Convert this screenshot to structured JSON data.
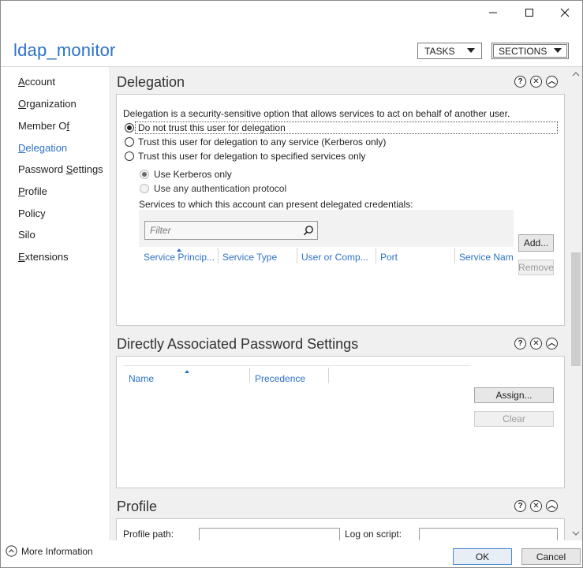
{
  "app": {
    "title": "ldap_monitor"
  },
  "header": {
    "tasks_label": "TASKS",
    "sections_label": "SECTIONS"
  },
  "nav": {
    "items": [
      {
        "pre": "",
        "u": "A",
        "post": "ccount",
        "active": false
      },
      {
        "pre": "",
        "u": "O",
        "post": "rganization",
        "active": false
      },
      {
        "pre": "Member O",
        "u": "f",
        "post": "",
        "active": false
      },
      {
        "pre": "",
        "u": "D",
        "post": "elegation",
        "active": true
      },
      {
        "pre": "Password ",
        "u": "S",
        "post": "ettings",
        "active": false
      },
      {
        "pre": "",
        "u": "P",
        "post": "rofile",
        "active": false
      },
      {
        "pre": "Policy",
        "u": "",
        "post": "",
        "active": false
      },
      {
        "pre": "Silo",
        "u": "",
        "post": "",
        "active": false
      },
      {
        "pre": "",
        "u": "E",
        "post": "xtensions",
        "active": false
      }
    ]
  },
  "delegation": {
    "title": "Delegation",
    "description": "Delegation is a security-sensitive option that allows services to act on behalf of another user.",
    "options": [
      {
        "label": "Do not trust this user for delegation",
        "checked": true
      },
      {
        "label": "Trust this user for delegation to any service (Kerberos only)",
        "checked": false
      },
      {
        "label": "Trust this user for delegation to specified services only",
        "checked": false
      }
    ],
    "sub_options": [
      {
        "label": "Use Kerberos only",
        "checked": true
      },
      {
        "label": "Use any authentication protocol",
        "checked": false
      }
    ],
    "services_label": "Services to which this account can present delegated credentials:",
    "filter_placeholder": "Filter",
    "columns": [
      "Service Princip...",
      "Service Type",
      "User or Comp...",
      "Port",
      "Service Name"
    ],
    "add_label": "Add...",
    "remove_label": "Remove"
  },
  "password_settings": {
    "title": "Directly Associated Password Settings",
    "columns": [
      "Name",
      "Precedence"
    ],
    "assign_label": "Assign...",
    "clear_label": "Clear"
  },
  "profile": {
    "title": "Profile",
    "profile_path_label": "Profile path:",
    "logon_script_label": "Log on script:"
  },
  "footer": {
    "more_info_label": "More Information",
    "ok_label": "OK",
    "cancel_label": "Cancel"
  },
  "colors": {
    "accent": "#2c72c7"
  },
  "icons": [
    "minimize-icon",
    "maximize-icon",
    "close-icon",
    "help-icon",
    "remove-section-icon",
    "collapse-section-icon",
    "search-icon",
    "chevron-up-circle-icon"
  ]
}
